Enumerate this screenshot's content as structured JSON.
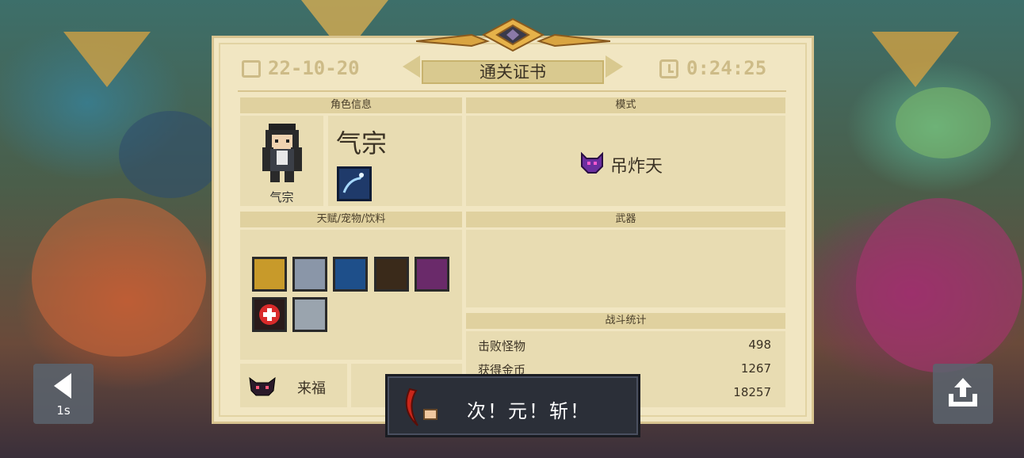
{
  "certificate": {
    "title": "通关证书",
    "date": "22-10-20",
    "time": "0:24:25"
  },
  "character": {
    "section": "角色信息",
    "name": "气宗",
    "portrait_label": "气宗"
  },
  "mode": {
    "section": "模式",
    "name": "吊炸天"
  },
  "talents": {
    "section": "天赋/宠物/饮料",
    "pet_name": "来福"
  },
  "weapons": {
    "section": "武器"
  },
  "stats": {
    "section": "战斗统计",
    "rows": [
      {
        "label": "击败怪物",
        "value": "498"
      },
      {
        "label": "获得金币",
        "value": "1267"
      },
      {
        "label": "",
        "value": "18257"
      }
    ]
  },
  "toast": {
    "text": "次！元！斩！"
  },
  "controls": {
    "back_timer": "1s"
  },
  "colors": {
    "paper": "#f1e6c2",
    "accent_gold": "#d9a441",
    "mode_purple": "#6b2fa0"
  }
}
